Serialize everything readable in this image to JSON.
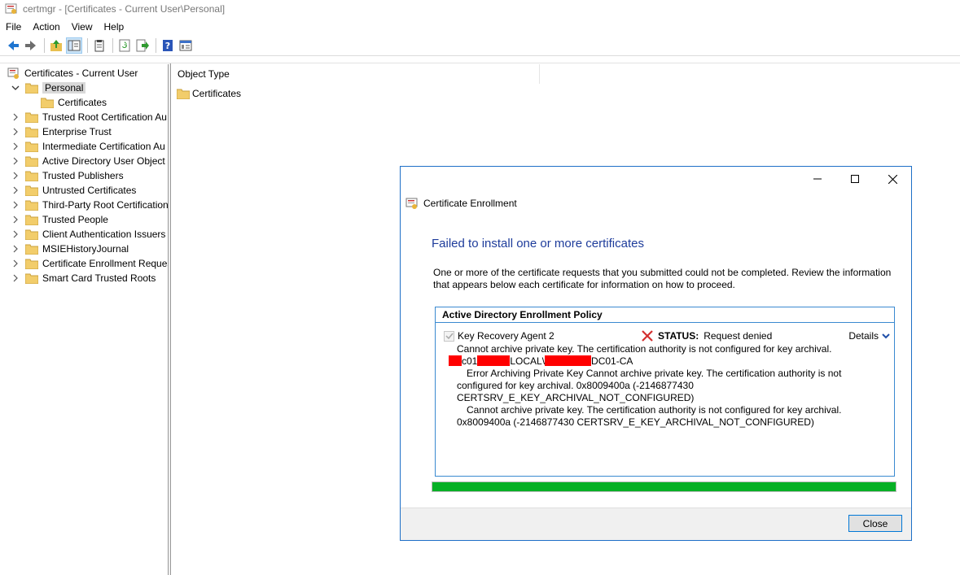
{
  "window": {
    "title": "certmgr - [Certificates - Current User\\Personal]"
  },
  "menu": [
    "File",
    "Action",
    "View",
    "Help"
  ],
  "toolbar": {
    "buttons": [
      "back-icon",
      "forward-icon",
      "up-folder-icon",
      "show-hide-tree-icon",
      "clipboard-icon",
      "refresh-icon",
      "export-list-icon",
      "help-icon",
      "properties-icon"
    ]
  },
  "tree": {
    "root": "Certificates - Current User",
    "personal": "Personal",
    "personal_child": "Certificates",
    "items": [
      "Trusted Root Certification Au",
      "Enterprise Trust",
      "Intermediate Certification Au",
      "Active Directory User Object",
      "Trusted Publishers",
      "Untrusted Certificates",
      "Third-Party Root Certification",
      "Trusted People",
      "Client Authentication Issuers",
      "MSIEHistoryJournal",
      "Certificate Enrollment Reques",
      "Smart Card Trusted Roots"
    ]
  },
  "list": {
    "column": "Object Type",
    "rows": [
      "Certificates"
    ]
  },
  "dialog": {
    "title": "Certificate Enrollment",
    "heading": "Failed to install one or more certificates",
    "description": "One or more of the certificate requests that you submitted could not be completed. Review the information that appears below each certificate for information on how to proceed.",
    "policy_title": "Active Directory Enrollment Policy",
    "certificate": "Key Recovery Agent 2",
    "status_label": "STATUS:",
    "status_value": "Request denied",
    "details_label": "Details",
    "messages": {
      "line1": "Cannot archive private key. The certification authority is not configured for key archival.",
      "ca_part1": "c01",
      "ca_part2": "LOCAL\\",
      "ca_part3": "DC01-CA",
      "line3": "Error Archiving Private Key  Cannot archive private key. The certification authority is not",
      "line4": "configured for key archival. 0x8009400a (-2146877430",
      "line5": "CERTSRV_E_KEY_ARCHIVAL_NOT_CONFIGURED)",
      "line6": "Cannot archive private key. The certification authority is not configured for key archival.",
      "line7": "0x8009400a (-2146877430 CERTSRV_E_KEY_ARCHIVAL_NOT_CONFIGURED)"
    },
    "progress": 1.0,
    "close_label": "Close"
  },
  "colors": {
    "accent": "#1e6fc7",
    "heading": "#1e3c9b",
    "progress": "#06b025",
    "error": "#d32f2f",
    "redaction": "#ff0000"
  }
}
